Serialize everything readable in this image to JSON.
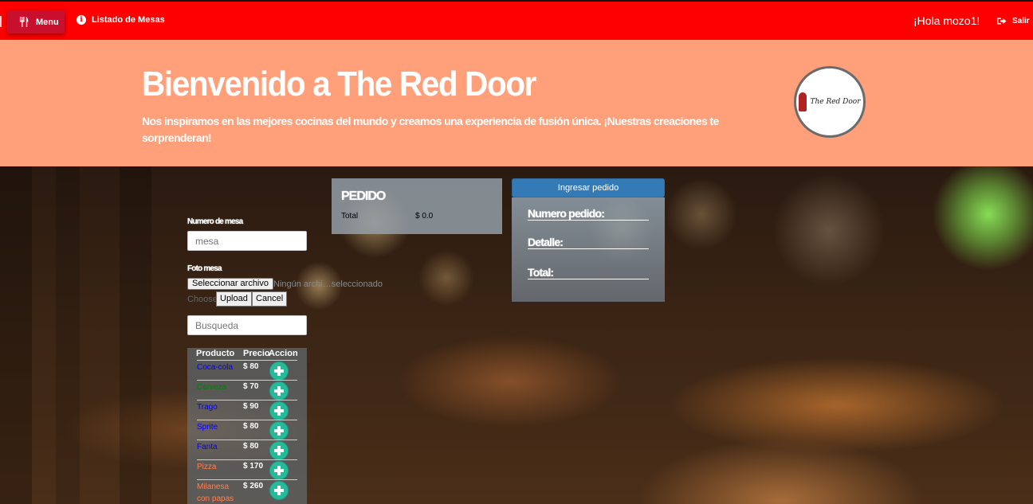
{
  "navbar": {
    "menu_label": "Menu",
    "tables_link": "Listado de Mesas",
    "greeting": "¡Hola mozo1!",
    "logout_label": "Salir"
  },
  "hero": {
    "title": "Bienvenido a The Red Door",
    "subtitle": "Nos inspiramos en las mejores cocinas del mundo y creamos una experiencia de fusión única. ¡Nuestras creaciones te sorprenderan!",
    "logo_text": "The Red Door"
  },
  "form": {
    "table_number_label": "Numero de mesa",
    "table_number_placeholder": "mesa",
    "photo_label": "Foto mesa",
    "file_button": "Seleccionar archivo",
    "file_none": "Ningún archi…seleccionado",
    "choose_text": "Choose",
    "upload_button": "Upload",
    "cancel_button": "Cancel",
    "search_placeholder": "Busqueda"
  },
  "products": {
    "headers": [
      "Producto",
      "Precio",
      "Accion"
    ],
    "rows": [
      {
        "name": "Coca-cola",
        "price": "$ 80",
        "color": "#0000ff"
      },
      {
        "name": "Cerveza",
        "price": "$ 70",
        "color": "#008000"
      },
      {
        "name": "Trago",
        "price": "$ 90",
        "color": "#0000ff"
      },
      {
        "name": "Sprite",
        "price": "$ 80",
        "color": "#0000ff"
      },
      {
        "name": "Fanta",
        "price": "$ 80",
        "color": "#0000ff"
      },
      {
        "name": "Pizza",
        "price": "$ 170",
        "color": "#ff7f50"
      },
      {
        "name": "Milanesa con papas",
        "price": "$ 260",
        "color": "#ff7f50"
      }
    ]
  },
  "pedido": {
    "title": "PEDIDO",
    "total_label": "Total",
    "total_value": "$ 0.0"
  },
  "summary": {
    "submit_button": "Ingresar pedido",
    "order_number_label": "Numero pedido:",
    "detail_label": "Detalle:",
    "total_label": "Total:"
  },
  "colors": {
    "navbar": "#ff0000",
    "menu_button": "#c8102e",
    "hero": "#ffa07a",
    "add_button": "#26b99a",
    "submit_button": "#337ab7"
  },
  "icons": [
    "utensils-icon",
    "info-icon",
    "sign-out-icon",
    "plus-circle-icon"
  ]
}
